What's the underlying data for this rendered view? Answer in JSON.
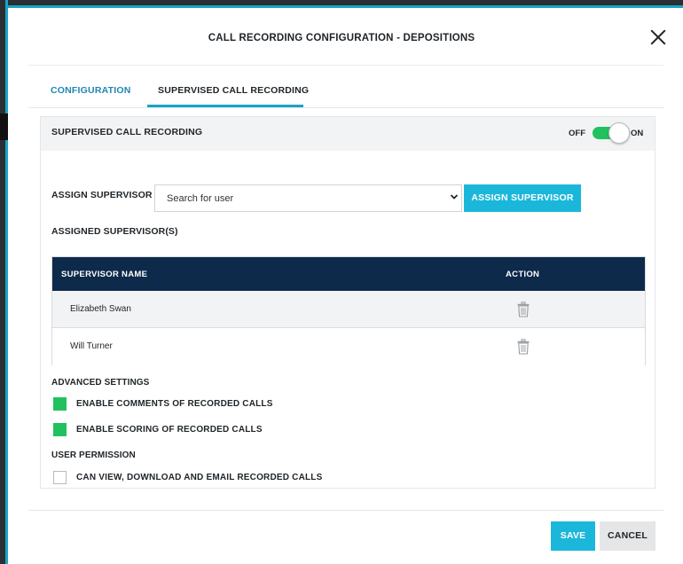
{
  "dialog": {
    "title": "CALL RECORDING CONFIGURATION - DEPOSITIONS"
  },
  "tabs": [
    {
      "label": "CONFIGURATION",
      "active": false
    },
    {
      "label": "SUPERVISED CALL RECORDING",
      "active": true
    }
  ],
  "panel": {
    "title": "SUPERVISED CALL RECORDING",
    "toggle": {
      "off_label": "OFF",
      "on_label": "ON",
      "state": "on"
    }
  },
  "assign": {
    "label": "ASSIGN SUPERVISOR",
    "search_placeholder": "Search for user",
    "button_label": "ASSIGN SUPERVISOR"
  },
  "assigned": {
    "label": "ASSIGNED SUPERVISOR(S)",
    "columns": [
      "SUPERVISOR NAME",
      "ACTION"
    ],
    "rows": [
      {
        "name": "Elizabeth Swan",
        "action_icon": "trash-icon"
      },
      {
        "name": "Will Turner",
        "action_icon": "trash-icon"
      }
    ]
  },
  "advanced": {
    "label": "ADVANCED SETTINGS",
    "options": [
      {
        "label": "ENABLE COMMENTS OF RECORDED CALLS",
        "checked": true
      },
      {
        "label": "ENABLE SCORING OF RECORDED CALLS",
        "checked": true
      }
    ]
  },
  "permission": {
    "label": "USER PERMISSION",
    "options": [
      {
        "label": "CAN VIEW, DOWNLOAD AND EMAIL RECORDED CALLS",
        "checked": false
      }
    ]
  },
  "footer": {
    "save_label": "SAVE",
    "cancel_label": "CANCEL"
  },
  "colors": {
    "accent": "#1bb7da",
    "tab_active_text": "#1e87b3",
    "table_header": "#0e2a4a",
    "toggle_on": "#22c160",
    "checkbox_on": "#22c160"
  }
}
